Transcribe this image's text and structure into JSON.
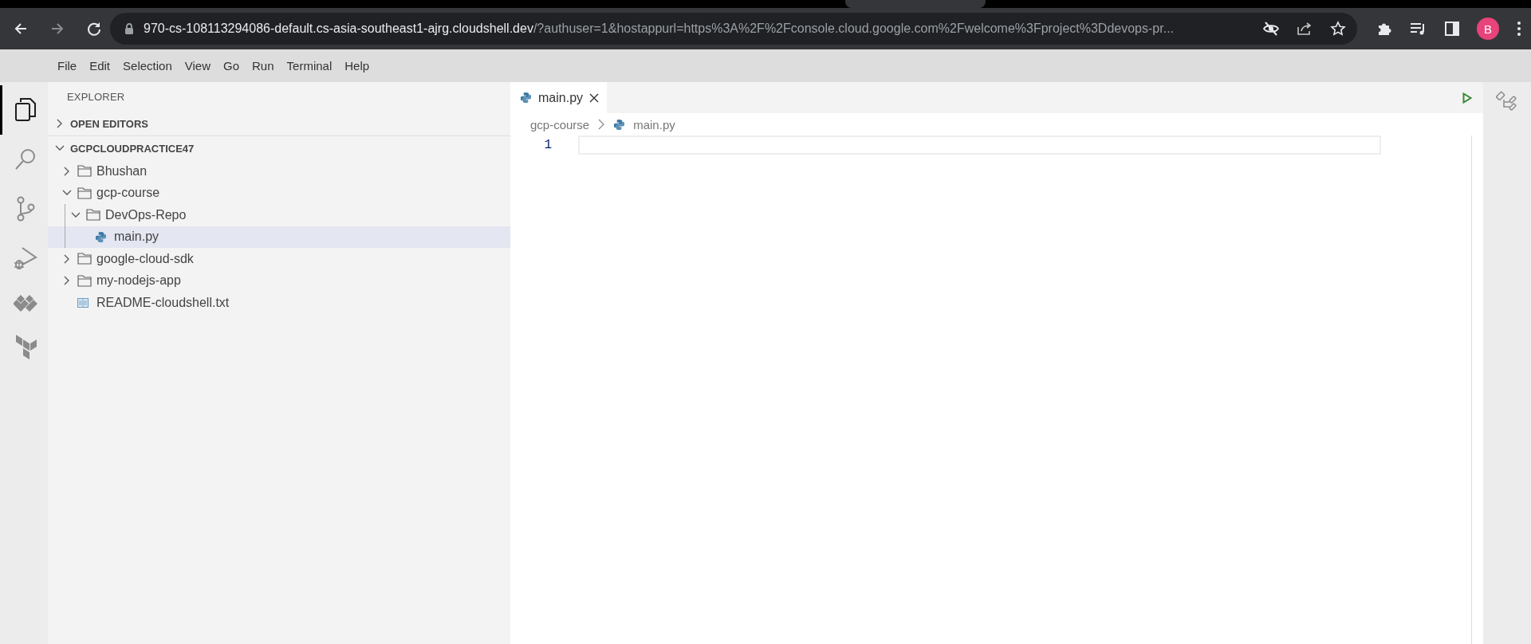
{
  "browser": {
    "url_host": "970-cs-108113294086-default.cs-asia-southeast1-ajrg.cloudshell.dev",
    "url_rest": "/?authuser=1&hostappurl=https%3A%2F%2Fconsole.cloud.google.com%2Fwelcome%3Fproject%3Ddevops-pr...",
    "profile_initial": "B"
  },
  "menu": [
    "File",
    "Edit",
    "Selection",
    "View",
    "Go",
    "Run",
    "Terminal",
    "Help"
  ],
  "activity_bar": [
    {
      "selected": true
    },
    {
      "selected": false
    },
    {
      "selected": false
    },
    {
      "selected": false
    },
    {
      "selected": false
    },
    {
      "selected": false
    }
  ],
  "explorer": {
    "title": "EXPLORER",
    "sections": [
      {
        "label": "OPEN EDITORS",
        "expanded": false
      },
      {
        "label": "GCPCLOUDPRACTICE47",
        "expanded": true,
        "tree": [
          {
            "label": "Bhushan",
            "kind": "folder",
            "expanded": false,
            "selected": false
          },
          {
            "label": "gcp-course",
            "kind": "folder",
            "expanded": true,
            "selected": false,
            "children": [
              {
                "label": "DevOps-Repo",
                "kind": "folder",
                "expanded": true,
                "selected": false,
                "children": [
                  {
                    "label": "main.py",
                    "kind": "python",
                    "selected": true
                  }
                ]
              }
            ]
          },
          {
            "label": "google-cloud-sdk",
            "kind": "folder",
            "expanded": false,
            "selected": false
          },
          {
            "label": "my-nodejs-app",
            "kind": "folder",
            "expanded": false,
            "selected": false
          },
          {
            "label": "README-cloudshell.txt",
            "kind": "text",
            "selected": false
          }
        ]
      }
    ]
  },
  "editor": {
    "tabs": [
      {
        "label": "main.py",
        "kind": "python",
        "selected": true
      }
    ],
    "breadcrumbs": [
      {
        "label": "gcp-course",
        "kind": "folder"
      },
      {
        "label": "main.py",
        "kind": "python"
      }
    ],
    "line_numbers": [
      "1"
    ]
  }
}
